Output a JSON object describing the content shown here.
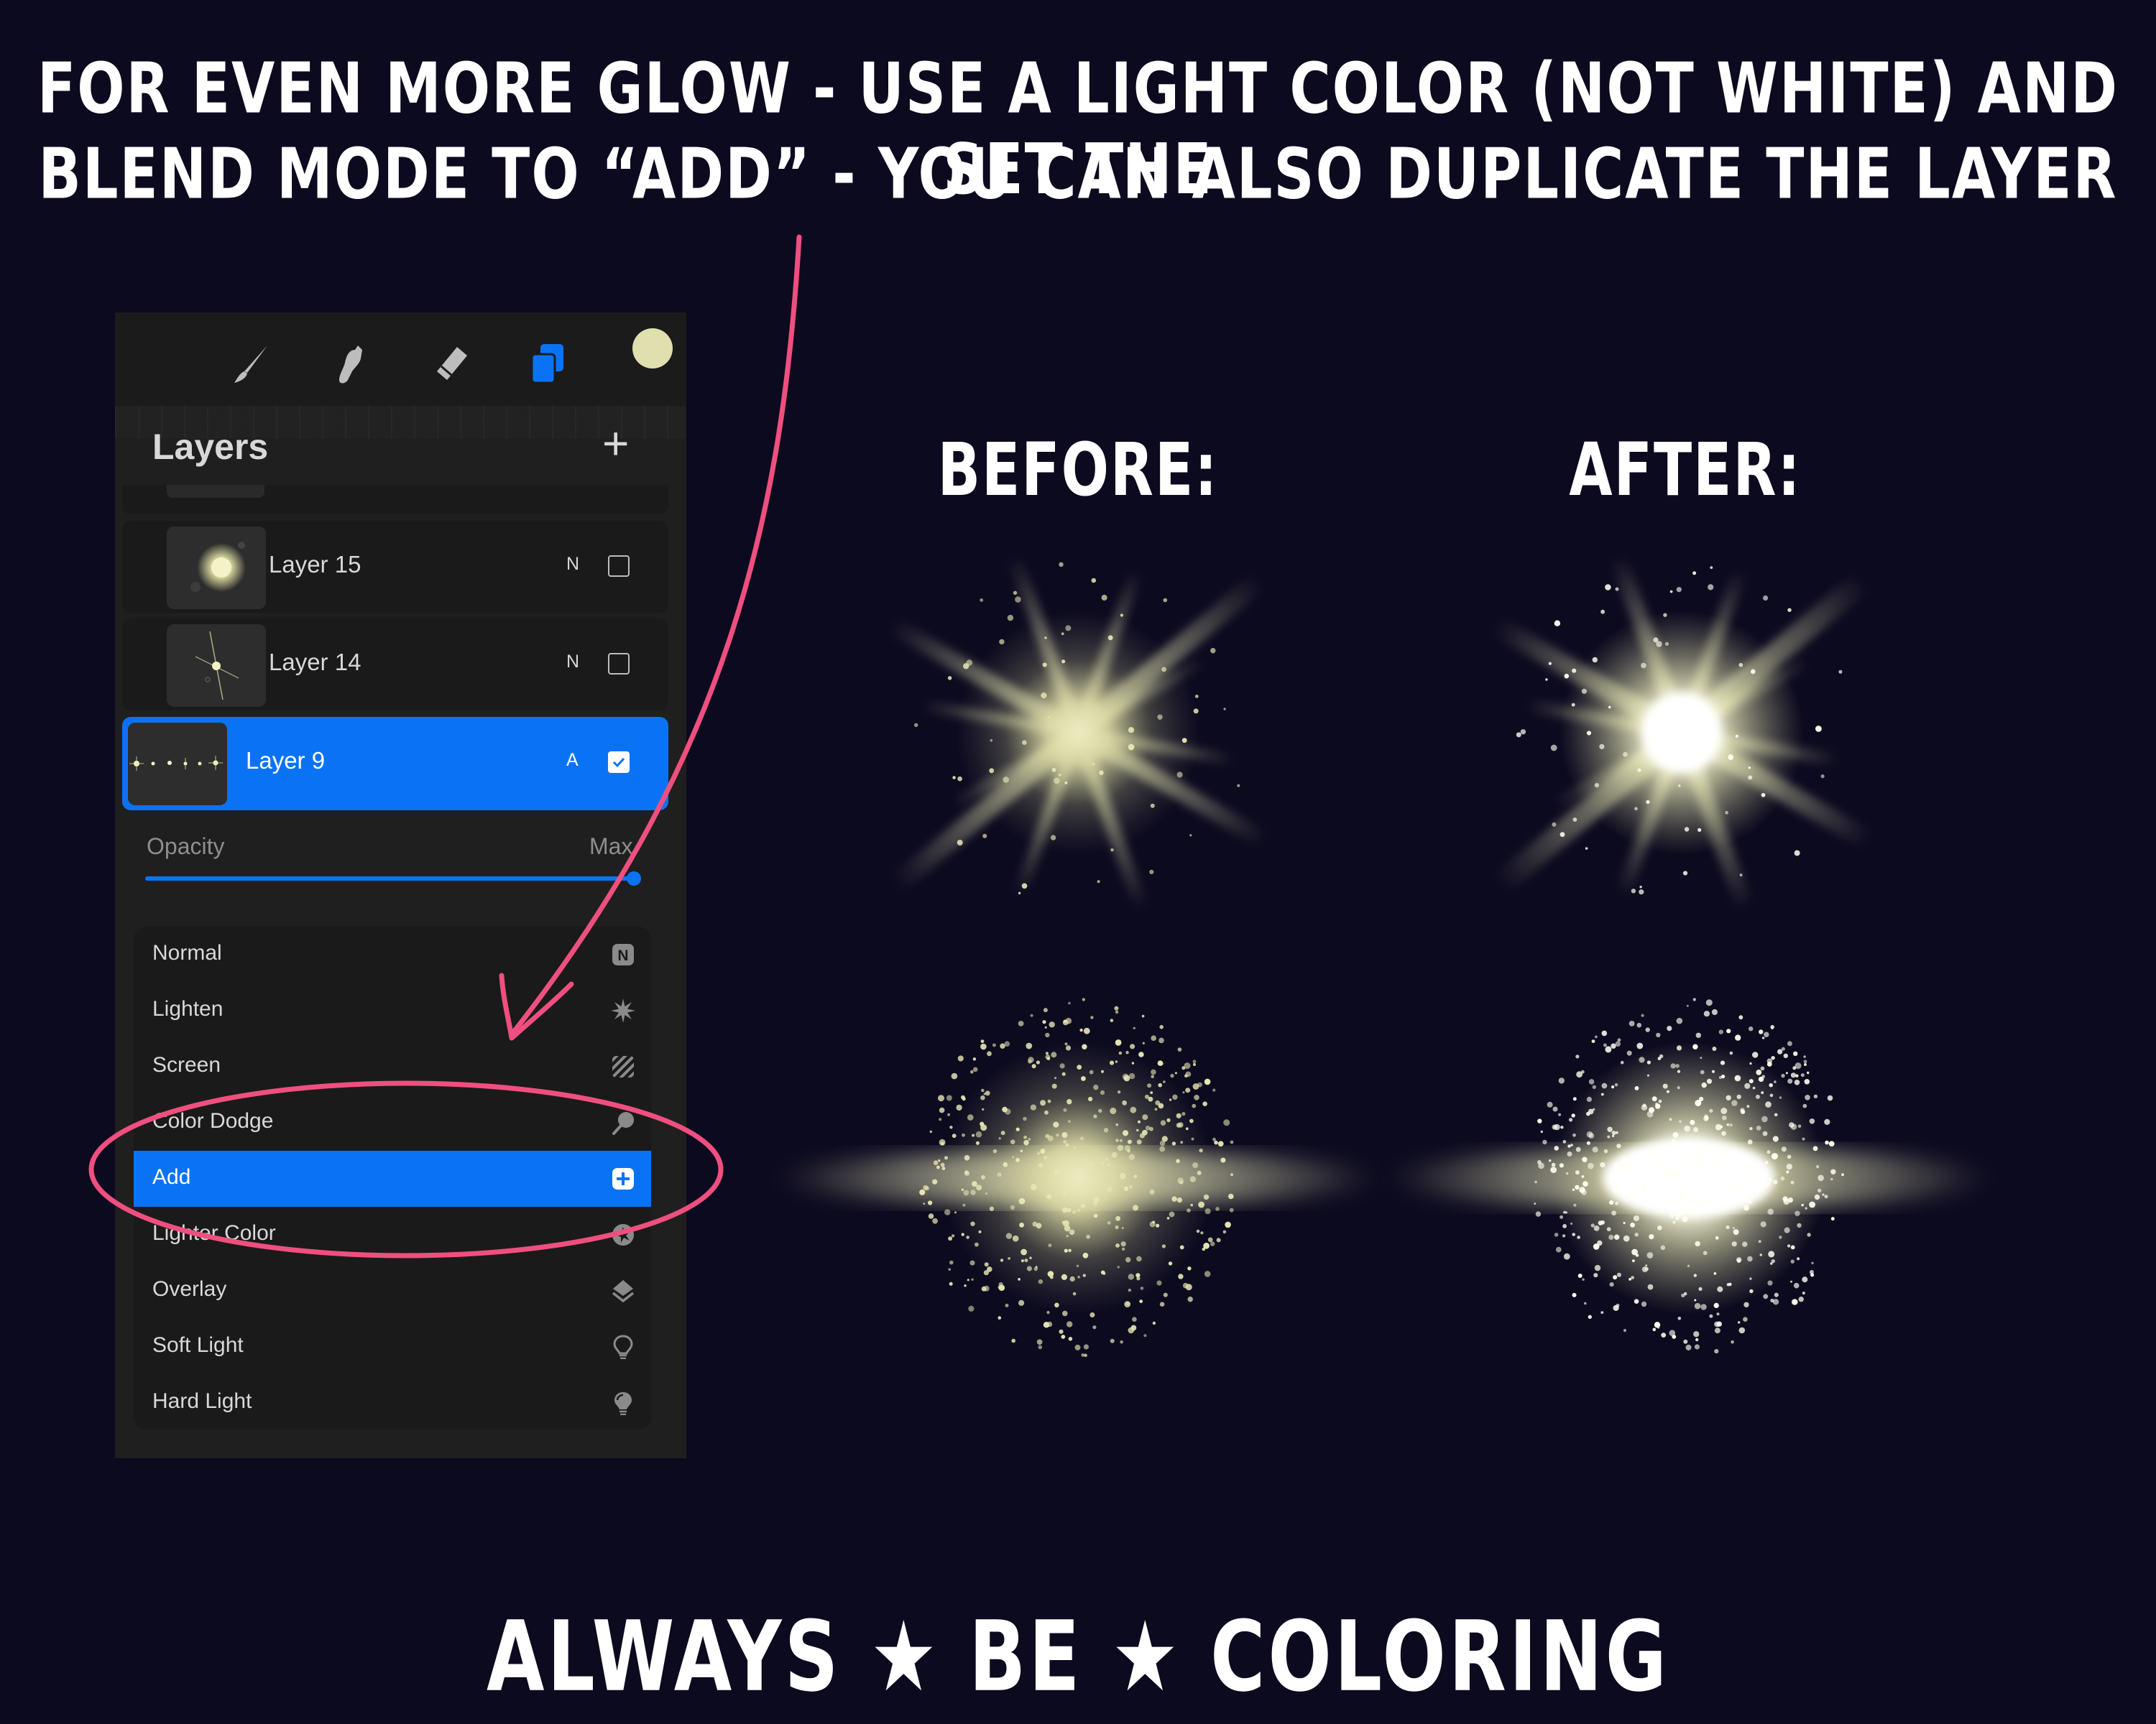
{
  "headline": {
    "line1": "For even more glow - use a light color (not white) and set the",
    "line2": "blend mode to “Add” - you can also duplicate the layer"
  },
  "comparison": {
    "before_label": "BEFORE:",
    "after_label": "AFTER:"
  },
  "footer": "ALWAYS ★ BE ★ COLORING",
  "toolbar": {
    "tools": [
      {
        "name": "brush",
        "icon": "brush-icon",
        "active": false
      },
      {
        "name": "smudge",
        "icon": "smudge-icon",
        "active": false
      },
      {
        "name": "eraser",
        "icon": "eraser-icon",
        "active": false
      },
      {
        "name": "layers",
        "icon": "layers-icon",
        "active": true
      }
    ],
    "current_color": "#e0dfae",
    "active_color": "#0a73f5"
  },
  "layers_panel": {
    "title": "Layers",
    "add_symbol": "+",
    "layers": [
      {
        "name": "Layer 15",
        "mode": "N",
        "visible": false,
        "selected": false
      },
      {
        "name": "Layer 14",
        "mode": "N",
        "visible": false,
        "selected": false
      },
      {
        "name": "Layer 9",
        "mode": "A",
        "visible": true,
        "selected": true
      }
    ],
    "opacity": {
      "label": "Opacity",
      "value_label": "Max",
      "value_percent": 100
    }
  },
  "blend_modes": {
    "selected": "Add",
    "items": [
      {
        "label": "Normal",
        "icon": "n-badge-icon"
      },
      {
        "label": "Lighten",
        "icon": "starburst-icon"
      },
      {
        "label": "Screen",
        "icon": "stripes-icon"
      },
      {
        "label": "Color Dodge",
        "icon": "dodge-icon"
      },
      {
        "label": "Add",
        "icon": "plus-square-icon"
      },
      {
        "label": "Lighter Color",
        "icon": "star-circle-icon"
      },
      {
        "label": "Overlay",
        "icon": "overlay-icon"
      },
      {
        "label": "Soft Light",
        "icon": "bulb-outline-icon"
      },
      {
        "label": "Hard Light",
        "icon": "bulb-filled-icon"
      }
    ]
  },
  "colors": {
    "background": "#0c0a1f",
    "annotation": "#ef4f7f",
    "glow": "#e6e6b4",
    "accent": "#0a73f5"
  }
}
